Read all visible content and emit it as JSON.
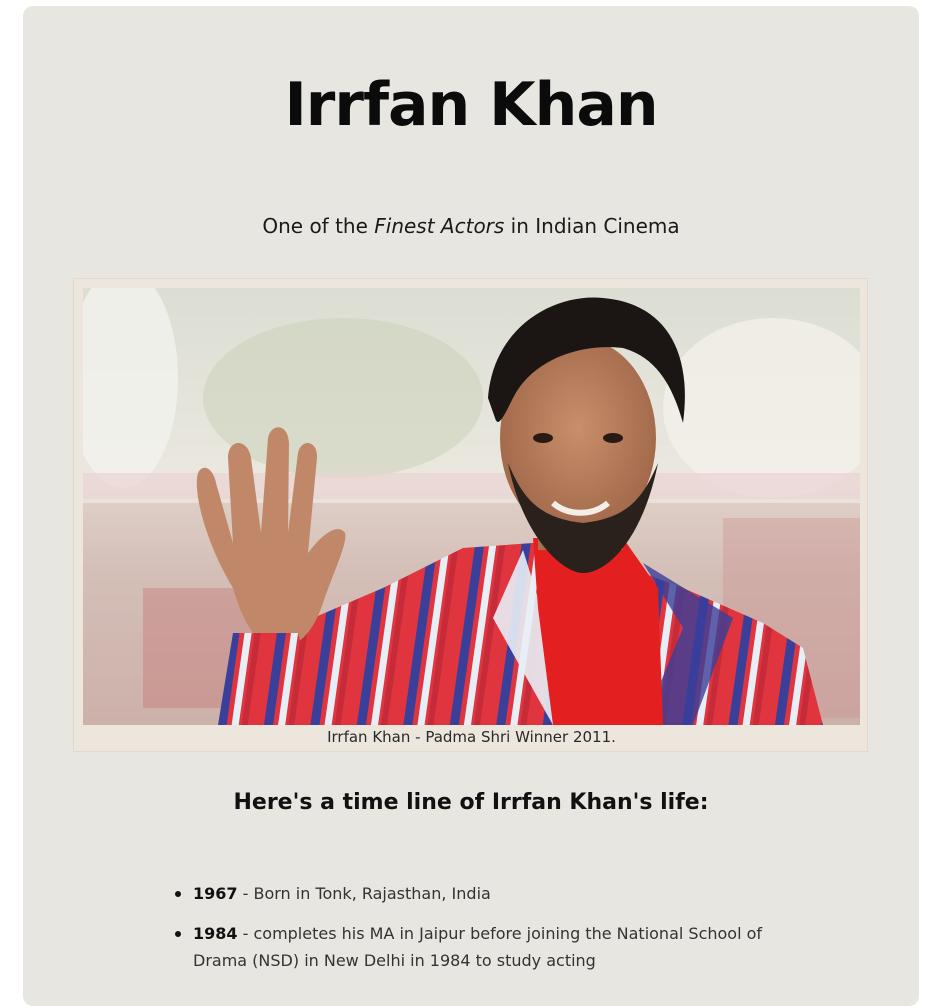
{
  "page": {
    "title": "Irrfan Khan",
    "subtitle": {
      "before": "One of the ",
      "emphasis": "Finest Actors",
      "after": " in Indian Cinema"
    },
    "figure": {
      "image_alt": "Irrfan Khan waving, wearing a red and blue striped blazer",
      "caption": "Irrfan Khan - Padma Shri Winner 2011."
    },
    "timeline_heading": "Here's a time line of Irrfan Khan's life:",
    "timeline": [
      {
        "year": "1967",
        "text": " - Born in Tonk, Rajasthan, India"
      },
      {
        "year": "1984",
        "text": " - completes his MA in Jaipur before joining the National School of Drama (NSD) in New Delhi in 1984 to study acting"
      }
    ]
  },
  "colors": {
    "card_background": "#e8e6e0",
    "figure_background": "#ece6dd",
    "text": "#111111"
  }
}
